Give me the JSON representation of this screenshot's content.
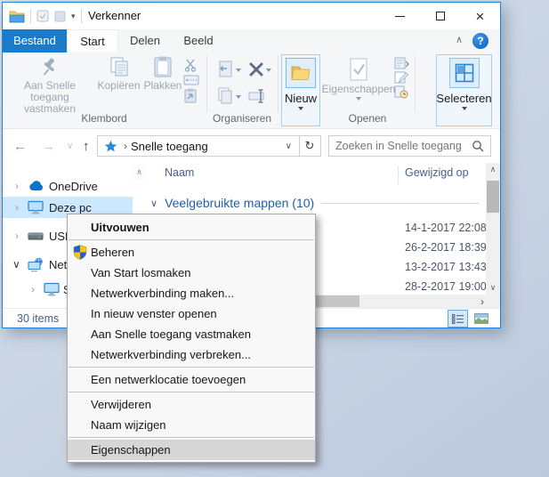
{
  "colors": {
    "accent_blue": "#1c7bc9",
    "window_border": "#1c83d9",
    "sidebar_selection": "#cce8ff",
    "menu_highlight": "#d6d6d6",
    "group_header_blue": "#1d5fae",
    "header_text_blue": "#44608c"
  },
  "glyphs": {
    "back": "←",
    "forward": "→",
    "recent_dropdown": "∨",
    "up": "↑",
    "breadcrumb_chevron": "›",
    "address_dropdown": "∨",
    "refresh": "↻",
    "help": "?",
    "ribbon_collapse": "∧",
    "tree_collapsed": "›",
    "tree_expanded": "∨",
    "scroll_up": "∧",
    "scroll_down": "∨",
    "scroll_right": "›",
    "close": "×",
    "qat_dropdown": "▾"
  },
  "window": {
    "title": "Verkenner",
    "tabs": [
      {
        "label": "Bestand"
      },
      {
        "label": "Start"
      },
      {
        "label": "Delen"
      },
      {
        "label": "Beeld"
      }
    ],
    "ribbon": {
      "pin_line1": "Aan Snelle toegang",
      "pin_line2": "vastmaken",
      "copy": "Kopiëren",
      "paste": "Plakken",
      "clipboard_group": "Klembord",
      "organize_group": "Organiseren",
      "new": "Nieuw",
      "properties": "Eigenschappen",
      "open_group": "Openen",
      "select": "Selecteren"
    },
    "addressbar": {
      "breadcrumb": "Snelle toegang",
      "search_placeholder": "Zoeken in Snelle toegang"
    },
    "sidebar": {
      "items": [
        {
          "label": "OneDrive"
        },
        {
          "label": "Deze pc"
        },
        {
          "label": "USB"
        },
        {
          "label": "Netw"
        },
        {
          "label": "SM"
        }
      ]
    },
    "main": {
      "columns": [
        {
          "label": "Naam"
        },
        {
          "label": "Gewijzigd op"
        }
      ],
      "group_header": "Veelgebruikte mappen (10)",
      "rows": [
        {
          "modified": "14-1-2017 22:08"
        },
        {
          "modified": "26-2-2017 18:39"
        },
        {
          "modified": "13-2-2017 13:43"
        },
        {
          "modified": "28-2-2017 19:00"
        }
      ]
    },
    "statusbar": {
      "count": "30 items"
    }
  },
  "context_menu": {
    "items": [
      {
        "label": "Uitvouwen"
      },
      {
        "label": "Beheren"
      },
      {
        "label": "Van Start losmaken"
      },
      {
        "label": "Netwerkverbinding maken..."
      },
      {
        "label": "In nieuw venster openen"
      },
      {
        "label": "Aan Snelle toegang vastmaken"
      },
      {
        "label": "Netwerkverbinding verbreken..."
      },
      {
        "label": "Een netwerklocatie toevoegen"
      },
      {
        "label": "Verwijderen"
      },
      {
        "label": "Naam wijzigen"
      },
      {
        "label": "Eigenschappen"
      }
    ]
  }
}
